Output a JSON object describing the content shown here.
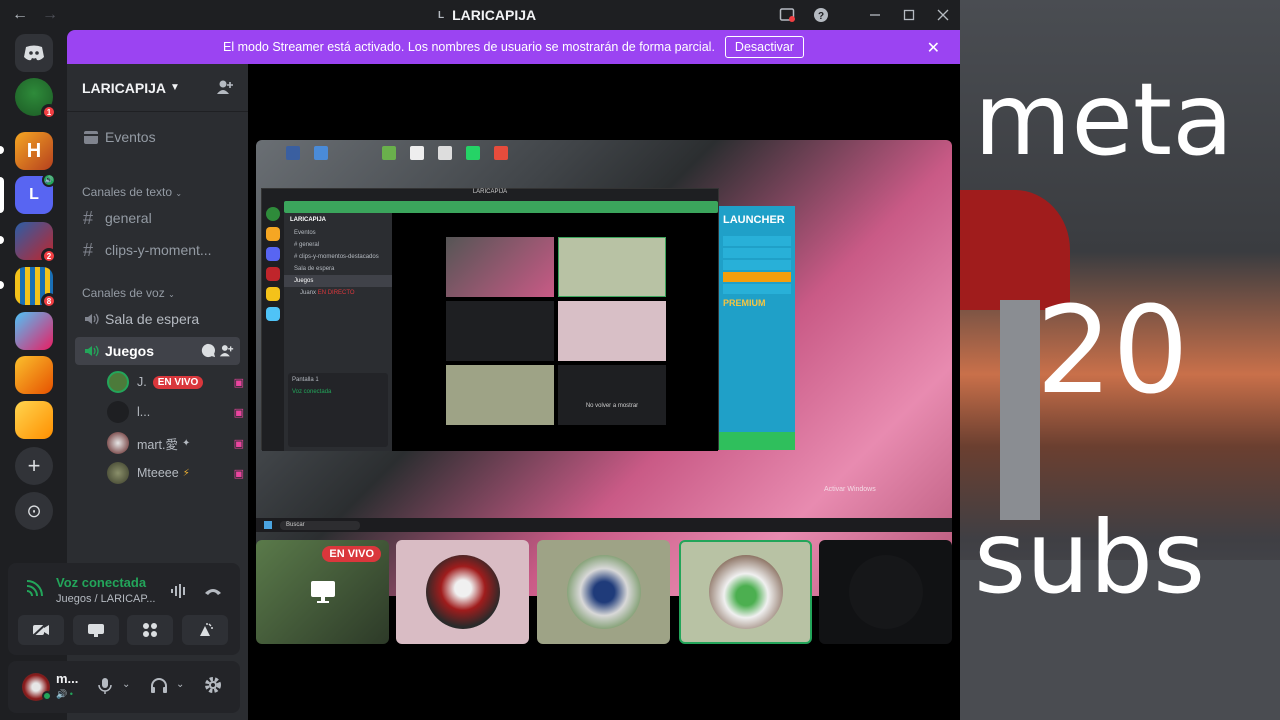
{
  "titlebar": {
    "title": "LARICAPIJA",
    "server_letter": "L",
    "back": "←",
    "forward": "→",
    "icons": [
      "inbox-icon",
      "help-icon",
      "minimize-icon",
      "maximize-icon",
      "close-icon"
    ]
  },
  "rail": {
    "servers": [
      {
        "name": "discord-home",
        "letter": ""
      },
      {
        "name": "server-1",
        "badge": "1"
      },
      {
        "name": "server-h",
        "letter": "H"
      },
      {
        "name": "server-l",
        "letter": "L"
      },
      {
        "name": "server-r",
        "badge": "2"
      },
      {
        "name": "server-s",
        "badge": "8"
      },
      {
        "name": "server-6"
      },
      {
        "name": "server-7"
      },
      {
        "name": "server-8"
      }
    ],
    "add_server": "+",
    "explore": "⊙"
  },
  "banner": {
    "text": "El modo Streamer está activado. Los nombres de usuario se mostrarán de forma parcial.",
    "button": "Desactivar",
    "close": "✕"
  },
  "sidebar": {
    "server_name": "LARICAPIJA",
    "events_label": "Eventos",
    "text_category": "Canales de texto",
    "text_channels": [
      "general",
      "clips-y-moment..."
    ],
    "voice_category": "Canales de voz",
    "voice_channels": [
      "Sala de espera",
      "Juegos"
    ],
    "members": [
      {
        "name": "J.",
        "live": "EN VIVO"
      },
      {
        "name": "l..."
      },
      {
        "name": "mart.愛"
      },
      {
        "name": "Mteeee"
      }
    ]
  },
  "voice_panel": {
    "status": "Voz conectada",
    "channel": "Juegos / LARICAP..."
  },
  "user_panel": {
    "name": "m..."
  },
  "stream": {
    "live_label": "EN VIVO",
    "nested": {
      "title": "LARICAPIJA",
      "server": "LARICAPIJA",
      "events": "Eventos",
      "channels": [
        "general",
        "clips-y-momentos-destacados"
      ],
      "voice_channels": [
        "Sala de espera",
        "Juegos"
      ],
      "voice_status": "Voz conectada",
      "screen_label": "Pantalla 1",
      "user": "Juanx",
      "live_tag": "EN DIRECTO",
      "dont_show": "No volver a mostrar",
      "launcher_title": "LAUNCHER",
      "launcher_premium": "PREMIUM",
      "search": "Buscar",
      "activate_windows": "Activar Windows"
    }
  },
  "overlay": {
    "line1": "meta",
    "line2": "20",
    "line3": "subs"
  },
  "colors": {
    "banner": "#9b44f2",
    "live": "#da373c",
    "connected": "#23a55a",
    "accent_pink": "#eb459f"
  }
}
